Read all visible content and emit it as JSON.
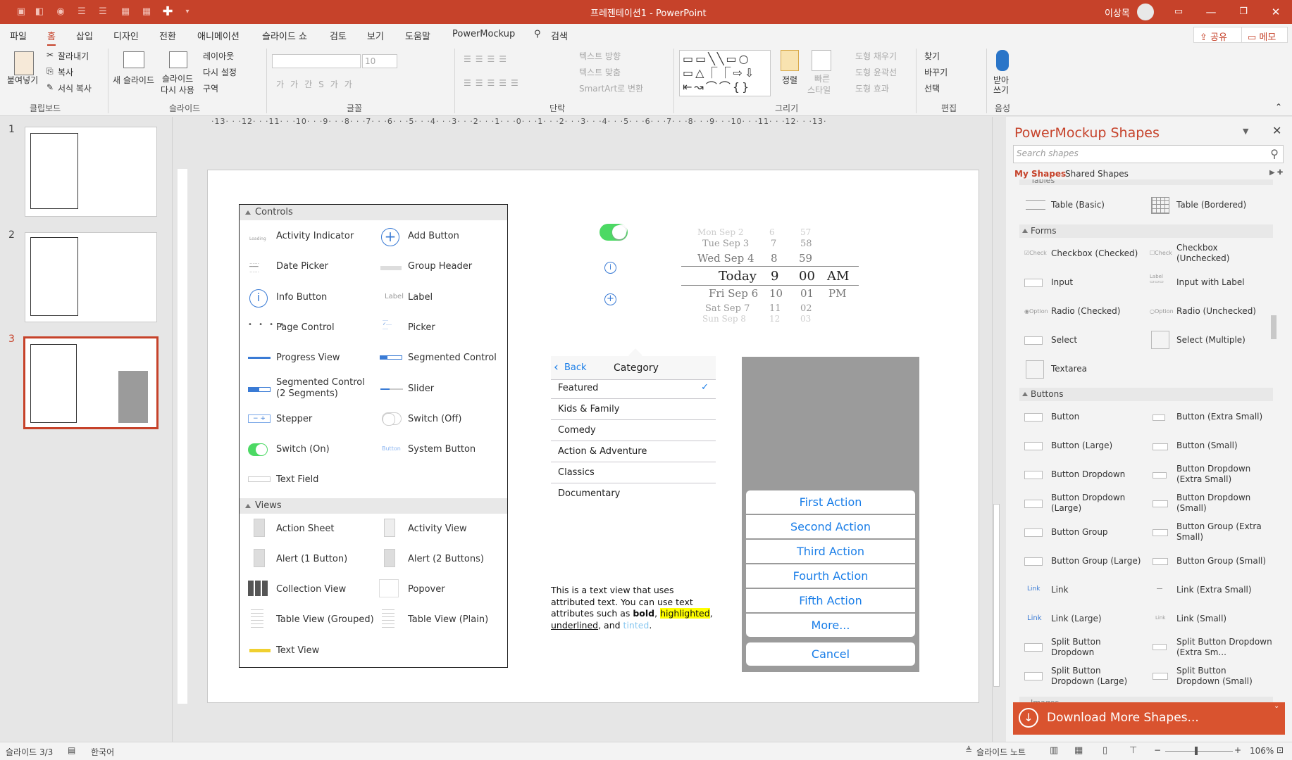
{
  "window": {
    "title": "프레젠테이션1  -  PowerPoint",
    "user": "이상목"
  },
  "menu": [
    "파일",
    "홈",
    "삽입",
    "디자인",
    "전환",
    "애니메이션",
    "슬라이드 쇼",
    "검토",
    "보기",
    "도움말",
    "PowerMockup"
  ],
  "search": "검색",
  "share": "공유",
  "memo": "메모",
  "ribbon": {
    "paste": "붙여넣기",
    "cut": "잘라내기",
    "copy": "복사",
    "format_painter": "서식 복사",
    "clipboard": "클립보드",
    "new_slide": "새 슬라이드",
    "reuse1": "슬라이드",
    "reuse2": "다시 사용",
    "layout": "레이아웃",
    "reset": "다시 설정",
    "section": "구역",
    "slides": "슬라이드",
    "font_size": "10",
    "font_group": "글꼴",
    "text_dir": "텍스트 방향",
    "align_text": "텍스트 맞춤",
    "smartart": "SmartArt로 변환",
    "para": "단락",
    "arrange": "정렬",
    "quick1": "빠른",
    "quick2": "스타일",
    "fill": "도형 채우기",
    "outline": "도형 윤곽선",
    "effect": "도형 효과",
    "drawing": "그리기",
    "find": "찾기",
    "replace": "바꾸기",
    "select": "선택",
    "edit": "편집",
    "dictate1": "받아",
    "dictate2": "쓰기",
    "voice": "음성"
  },
  "ruler": "·13· · ·12· · ·11· · ·10· · ·9· · ·8· · ·7· · ·6· · ·5· · ·4· · ·3· · ·2· · ·1· · ·0· · ·1· · ·2· · ·3· · ·4· · ·5· · ·6· · ·7· · ·8· · ·9· · ·10· · ·11· · ·12· · ·13·",
  "slides": [
    {
      "n": "1"
    },
    {
      "n": "2"
    },
    {
      "n": "3"
    }
  ],
  "controls": {
    "header": "Controls",
    "items": [
      "Activity Indicator",
      "Add Button",
      "Date Picker",
      "Group Header",
      "Info Button",
      "Label",
      "Page Control",
      "Picker",
      "Progress View",
      "Segmented Control",
      "Segmented Control (2 Segments)",
      "Slider",
      "Stepper",
      "Switch (Off)",
      "Switch (On)",
      "System Button",
      "Text Field"
    ]
  },
  "views": {
    "header": "Views",
    "items": [
      "Action Sheet",
      "Activity View",
      "Alert (1 Button)",
      "Alert (2 Buttons)",
      "Collection View",
      "Popover",
      "Table View (Grouped)",
      "Table View (Plain)",
      "Text View"
    ]
  },
  "icon_text": {
    "loading": "Loading",
    "label": "Label",
    "button": "Button"
  },
  "picker": {
    "rows": [
      [
        "Mon Sep 2",
        "6",
        "57",
        ""
      ],
      [
        "Tue Sep 3",
        "7",
        "58",
        ""
      ],
      [
        "Wed Sep 4",
        "8",
        "59",
        ""
      ],
      [
        "Today",
        "9",
        "00",
        "AM"
      ],
      [
        "Fri Sep 6",
        "10",
        "01",
        "PM"
      ],
      [
        "Sat Sep 7",
        "11",
        "02",
        ""
      ],
      [
        "Sun Sep 8",
        "12",
        "03",
        ""
      ]
    ]
  },
  "nav": {
    "back": "Back",
    "title": "Category"
  },
  "categories": [
    "Featured",
    "Kids & Family",
    "Comedy",
    "Action & Adventure",
    "Classics",
    "Documentary"
  ],
  "textview": {
    "p1": "This is a text view that uses attributed text. You can use text attributes such as ",
    "bold": "bold",
    "c1": ", ",
    "highlighted": "highlighted",
    "c2": ", ",
    "underlined": "underlined",
    "c3": ", and ",
    "tinted": "tinted",
    "end": "."
  },
  "actions": [
    "First Action",
    "Second Action",
    "Third Action",
    "Fourth Action",
    "Fifth Action",
    "More..."
  ],
  "cancel": "Cancel",
  "panel": {
    "title": "PowerMockup Shapes",
    "search_placeholder": "Search shapes",
    "tab_my": "My Shapes",
    "tab_shared": "Shared Shapes",
    "tables_partial": "Tables",
    "images_partial": "Images",
    "table_items": [
      "Table (Basic)",
      "Table (Bordered)"
    ],
    "forms": "Forms",
    "form_items": [
      "Checkbox (Checked)",
      "Checkbox (Unchecked)",
      "Input",
      "Input with Label",
      "Radio (Checked)",
      "Radio (Unchecked)",
      "Select",
      "Select (Multiple)",
      "Textarea"
    ],
    "buttons": "Buttons",
    "button_items": [
      "Button",
      "Button (Extra Small)",
      "Button (Large)",
      "Button (Small)",
      "Button Dropdown",
      "Button Dropdown (Extra Small)",
      "Button Dropdown (Large)",
      "Button Dropdown (Small)",
      "Button Group",
      "Button Group (Extra Small)",
      "Button Group (Large)",
      "Button Group (Small)",
      "Link",
      "Link (Extra Small)",
      "Link (Large)",
      "Link (Small)",
      "Split Button Dropdown",
      "Split Button Dropdown  (Extra Sm...",
      "Split Button Dropdown (Large)",
      "Split Button Dropdown (Small)"
    ],
    "icon_labels": {
      "check": "Check",
      "option": "Option",
      "label": "Label",
      "link": "Link"
    },
    "download": "Download More Shapes..."
  },
  "status": {
    "slide": "슬라이드 3/3",
    "lang": "한국어",
    "notes": "슬라이드 노트",
    "zoom": "106%"
  },
  "colors": {
    "accent": "#c6422a",
    "ios_blue": "#1a7ee8",
    "switch_green": "#4cd964"
  }
}
